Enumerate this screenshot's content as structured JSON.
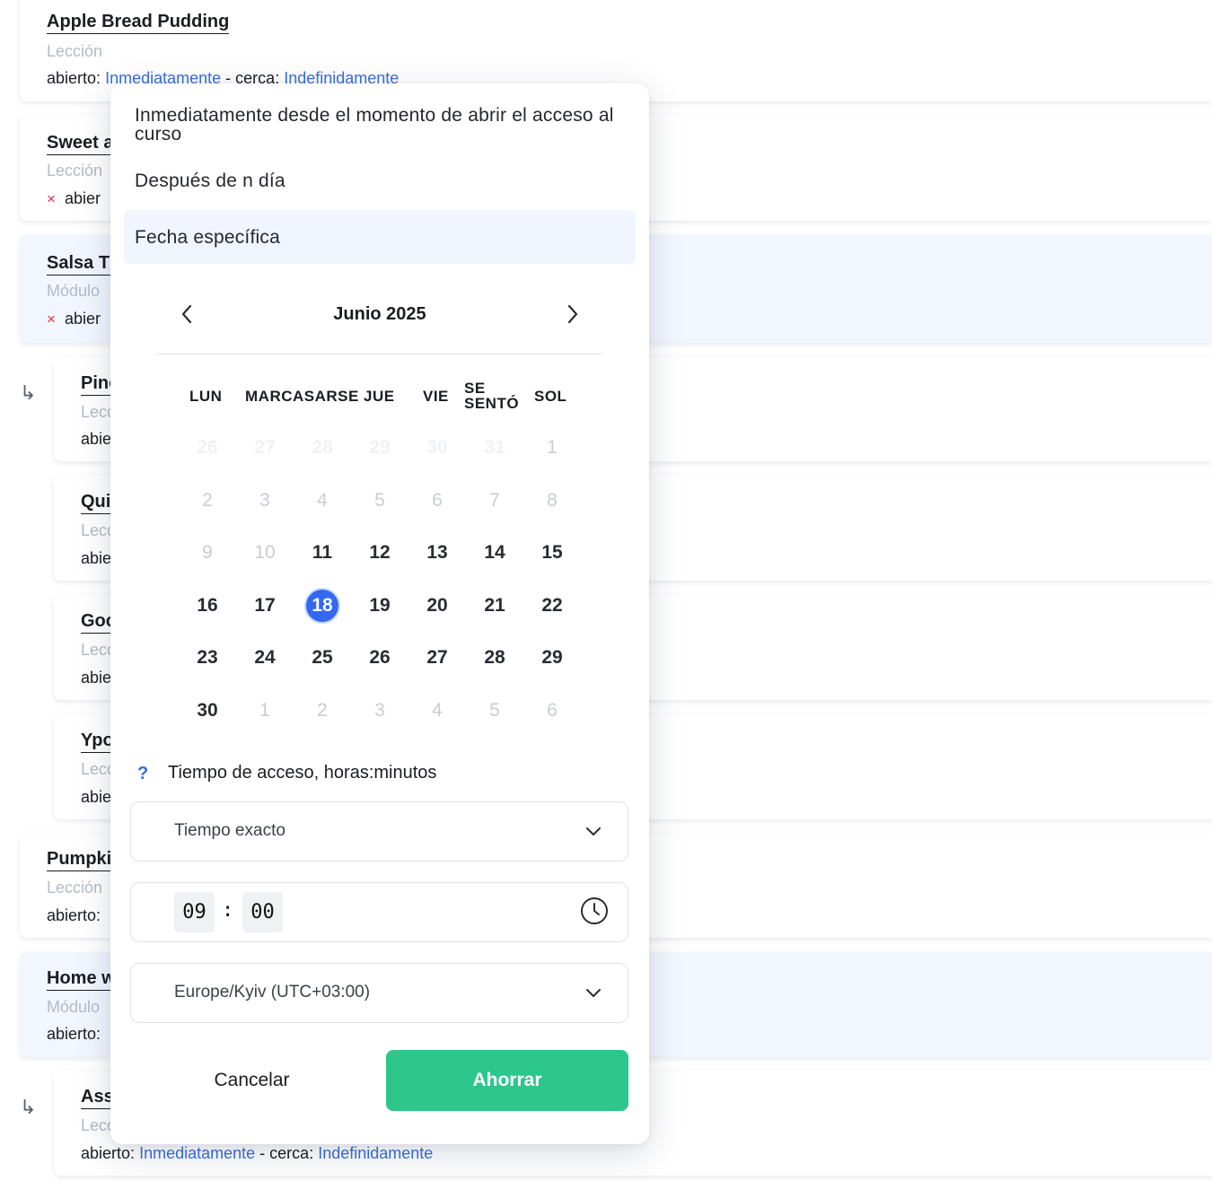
{
  "list": {
    "items": [
      {
        "title": "Apple Bread Pudding",
        "type": "Lección",
        "open_label": "abierto:",
        "open_value": "Inmediatamente",
        "sep": "-",
        "close_label": "cerca:",
        "close_value": "Indefinidamente"
      },
      {
        "title": "Sweet a",
        "type": "Lección",
        "meta": "abier"
      },
      {
        "title": "Salsa Ti",
        "type": "Módulo",
        "meta": "abier"
      },
      {
        "title": "Pinc",
        "type": "Lecc",
        "meta": "abie"
      },
      {
        "title": "Qui",
        "type": "Lecc",
        "meta": "abie"
      },
      {
        "title": "Goc",
        "type": "Lecc",
        "meta": "abie"
      },
      {
        "title": "Ypo",
        "type": "Lecc",
        "meta": "abie"
      },
      {
        "title": "Pumpki",
        "type": "Lección",
        "meta": "abierto:"
      },
      {
        "title": "Home w",
        "type": "Módulo",
        "meta": "abierto:"
      },
      {
        "title": "Ass",
        "type": "Lecc",
        "open_label": "abierto:",
        "open_value": "Inmediatamente",
        "sep": "-",
        "close_label": "cerca:",
        "close_value": "Indefinidamente"
      }
    ],
    "x_mark": "×",
    "nested_arrow": "↳"
  },
  "popover": {
    "options": [
      "Inmediatamente desde el momento de abrir el acceso al curso",
      "Después de n día",
      "Fecha específica"
    ],
    "selected_option": "Fecha específica",
    "calendar": {
      "month_label": "Junio 2025",
      "weekdays": [
        "LUN",
        "MARCASARSE",
        "JUE",
        "VIE",
        "SE SENTÓ",
        "SOL"
      ],
      "weeks": [
        [
          "26",
          "27",
          "28",
          "29",
          "30",
          "31",
          "1"
        ],
        [
          "2",
          "3",
          "4",
          "5",
          "6",
          "7",
          "8"
        ],
        [
          "9",
          "10",
          "11",
          "12",
          "13",
          "14",
          "15"
        ],
        [
          "16",
          "17",
          "18",
          "19",
          "20",
          "21",
          "22"
        ],
        [
          "23",
          "24",
          "25",
          "26",
          "27",
          "28",
          "29"
        ],
        [
          "30",
          "1",
          "2",
          "3",
          "4",
          "5",
          "6"
        ]
      ],
      "selected_day": "18"
    },
    "help_glyph": "?",
    "access_time_label": "Tiempo de acceso, horas:minutos",
    "time_mode": "Tiempo exacto",
    "time_hours": "09",
    "time_sep": ":",
    "time_minutes": "00",
    "timezone": "Europe/Kyiv (UTC+03:00)",
    "cancel_label": "Cancelar",
    "save_label": "Ahorrar"
  }
}
